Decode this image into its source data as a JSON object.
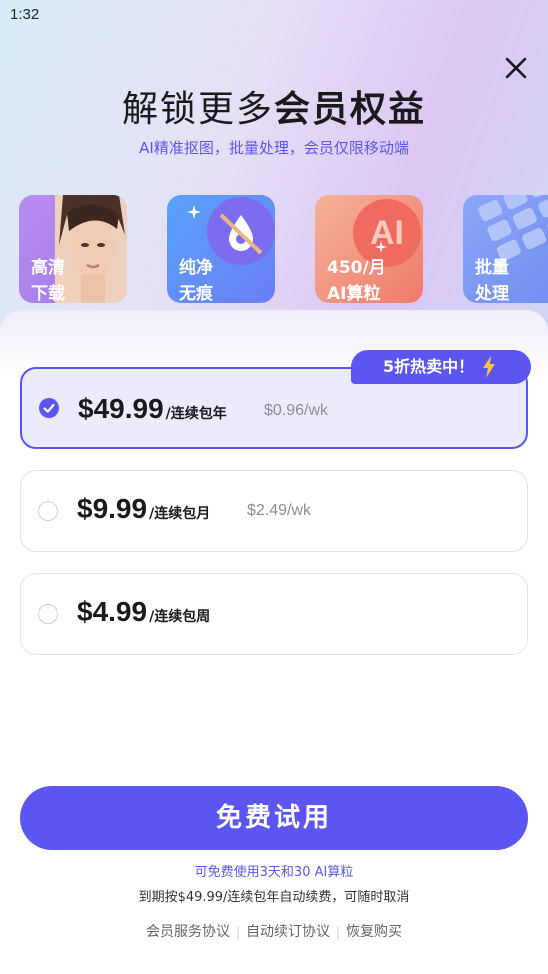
{
  "status_bar": {
    "time": "1:32"
  },
  "header": {
    "title_regular": "解锁更多",
    "title_bold": "会员权益",
    "subtitle": "AI精准抠图，批量处理，会员仅限移动端"
  },
  "features": [
    {
      "label": "高清\n下载",
      "icon": "portrait-photo"
    },
    {
      "label": "纯净\n无痕",
      "icon": "watermark-free-drop"
    },
    {
      "label": "450/月\nAI算粒",
      "icon": "ai-badge"
    },
    {
      "label": "批量\n处理",
      "icon": "batch-tiles"
    }
  ],
  "promo_badge": "5折热卖中！",
  "plans": [
    {
      "price": "$49.99",
      "period": "/连续包年",
      "per_week": "$0.96/wk",
      "selected": true
    },
    {
      "price": "$9.99",
      "period": "/连续包月",
      "per_week": "$2.49/wk",
      "selected": false
    },
    {
      "price": "$4.99",
      "period": "/连续包周",
      "per_week": "",
      "selected": false
    }
  ],
  "cta": {
    "label": "免费试用"
  },
  "notes": {
    "trial": "可免费使用3天和30 AI算粒",
    "renewal": "到期按$49.99/连续包年自动续费，可随时取消"
  },
  "footer": {
    "links": [
      "会员服务协议",
      "自动续订协议",
      "恢复购买"
    ]
  },
  "colors": {
    "accent": "#5b55f2",
    "accent_text": "#5a57f0",
    "selected_bg": "#ecebfd"
  }
}
